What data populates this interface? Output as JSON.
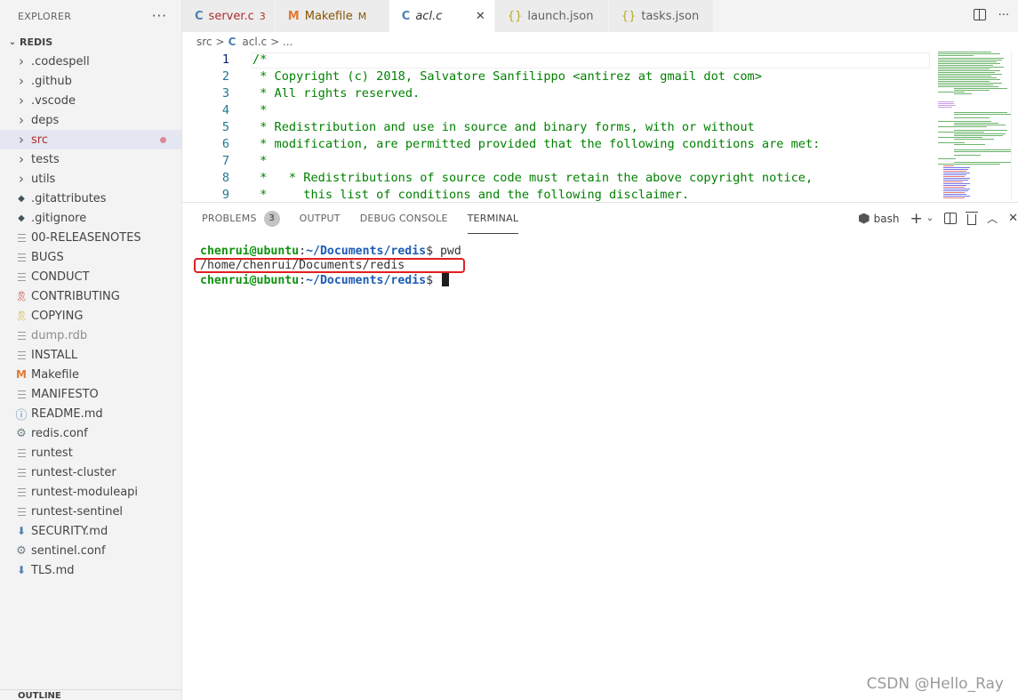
{
  "explorer": {
    "title": "EXPLORER",
    "more": "···",
    "root": "REDIS",
    "items": [
      {
        "label": ".codespell",
        "type": "folder"
      },
      {
        "label": ".github",
        "type": "folder"
      },
      {
        "label": ".vscode",
        "type": "folder"
      },
      {
        "label": "deps",
        "type": "folder"
      },
      {
        "label": "src",
        "type": "folder",
        "selected": true,
        "modified": true
      },
      {
        "label": "tests",
        "type": "folder"
      },
      {
        "label": "utils",
        "type": "folder"
      },
      {
        "label": ".gitattributes",
        "type": "git-icon"
      },
      {
        "label": ".gitignore",
        "type": "git-icon"
      },
      {
        "label": "00-RELEASENOTES",
        "type": "text-icon"
      },
      {
        "label": "BUGS",
        "type": "text-icon"
      },
      {
        "label": "CONDUCT",
        "type": "text-icon"
      },
      {
        "label": "CONTRIBUTING",
        "type": "license-red-icon"
      },
      {
        "label": "COPYING",
        "type": "license-yellow-icon"
      },
      {
        "label": "dump.rdb",
        "type": "text-icon",
        "dim": true
      },
      {
        "label": "INSTALL",
        "type": "text-icon"
      },
      {
        "label": "Makefile",
        "type": "makefile-icon"
      },
      {
        "label": "MANIFESTO",
        "type": "text-icon"
      },
      {
        "label": "README.md",
        "type": "info-icon"
      },
      {
        "label": "redis.conf",
        "type": "gear-icon"
      },
      {
        "label": "runtest",
        "type": "text-icon"
      },
      {
        "label": "runtest-cluster",
        "type": "text-icon"
      },
      {
        "label": "runtest-moduleapi",
        "type": "text-icon"
      },
      {
        "label": "runtest-sentinel",
        "type": "text-icon"
      },
      {
        "label": "SECURITY.md",
        "type": "download-icon"
      },
      {
        "label": "sentinel.conf",
        "type": "gear-icon"
      },
      {
        "label": "TLS.md",
        "type": "download-icon"
      }
    ],
    "outline": "OUTLINE"
  },
  "tabs": [
    {
      "icon": "C",
      "label": "server.c",
      "badge": "3"
    },
    {
      "icon": "M",
      "label": "Makefile",
      "badge": "M"
    },
    {
      "icon": "C",
      "label": "acl.c",
      "close": "✕"
    },
    {
      "icon": "{}",
      "label": "launch.json"
    },
    {
      "icon": "{}",
      "label": "tasks.json"
    }
  ],
  "breadcrumb": {
    "folder": "src",
    "sep": ">",
    "file_icon": "C",
    "file": "acl.c",
    "more": "> ..."
  },
  "editor": {
    "lines": [
      {
        "n": "1",
        "text": "/*"
      },
      {
        "n": "2",
        "text": " * Copyright (c) 2018, Salvatore Sanfilippo <antirez at gmail dot com>"
      },
      {
        "n": "3",
        "text": " * All rights reserved."
      },
      {
        "n": "4",
        "text": " *"
      },
      {
        "n": "5",
        "text": " * Redistribution and use in source and binary forms, with or without"
      },
      {
        "n": "6",
        "text": " * modification, are permitted provided that the following conditions are met:"
      },
      {
        "n": "7",
        "text": " *"
      },
      {
        "n": "8",
        "text": " *   * Redistributions of source code must retain the above copyright notice,"
      },
      {
        "n": "9",
        "text": " *     this list of conditions and the following disclaimer."
      }
    ]
  },
  "panel": {
    "tabs": [
      {
        "label": "PROBLEMS",
        "badge": "3"
      },
      {
        "label": "OUTPUT"
      },
      {
        "label": "DEBUG CONSOLE"
      },
      {
        "label": "TERMINAL",
        "active": true
      }
    ],
    "shell": "bash",
    "terminal": {
      "user_host": "chenrui@ubuntu",
      "colon": ":",
      "path": "~/Documents/redis",
      "prompt_char": "$",
      "command": " pwd",
      "output": "/home/chenrui/Documents/redis"
    }
  },
  "watermark": "CSDN @Hello_Ray"
}
